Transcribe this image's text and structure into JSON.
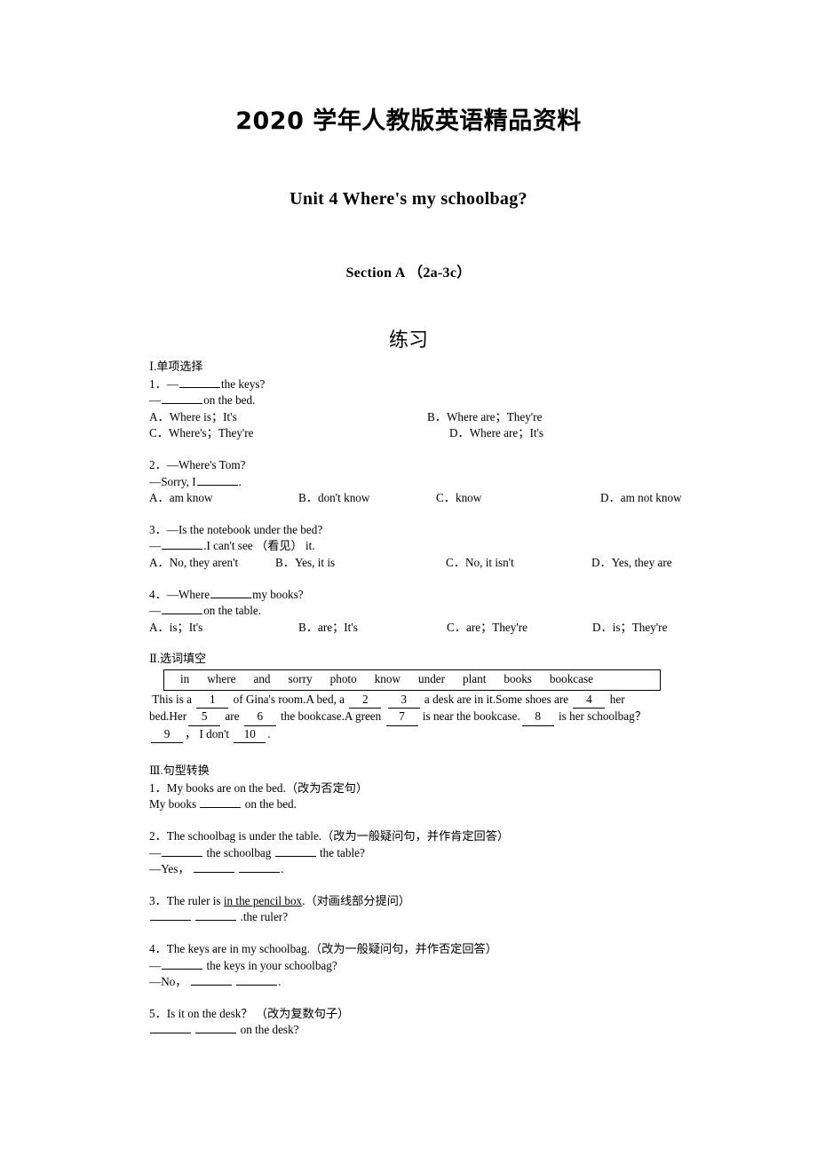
{
  "header": {
    "doc_title": "2020 学年人教版英语精品资料",
    "unit_title": "Unit 4    Where's my schoolbag?",
    "section_title": "Section A  （2a-3c）",
    "exercise_title": "练习"
  },
  "part1": {
    "heading": "Ⅰ.单项选择",
    "questions": [
      {
        "stem": "1．—",
        "stem_rest": "the keys?",
        "answer_line_prefix": "—",
        "answer_line_rest": "on the bed.",
        "options": [
          {
            "letter": "A．",
            "text": "Where is；It's"
          },
          {
            "letter": "B．",
            "text": "Where are；They're"
          },
          {
            "letter": "C．",
            "text": "Where's；They're"
          },
          {
            "letter": "D．",
            "text": "Where are；It's"
          }
        ]
      },
      {
        "stem": "2．—Where's Tom?",
        "answer_line_prefix": "—Sorry, I",
        "answer_line_rest": ".",
        "options": [
          {
            "letter": "A．",
            "text": "am know"
          },
          {
            "letter": "B．",
            "text": "don't know"
          },
          {
            "letter": "C．",
            "text": "know"
          },
          {
            "letter": "D．",
            "text": "am not know"
          }
        ]
      },
      {
        "stem": "3．—Is the notebook under the bed?",
        "answer_line_prefix": "—",
        "answer_line_rest": ".I can't see （看见） it.",
        "options": [
          {
            "letter": "A．",
            "text": "No, they aren't"
          },
          {
            "letter": "B．",
            "text": "Yes, it is"
          },
          {
            "letter": "C．",
            "text": "No, it isn't"
          },
          {
            "letter": "D．",
            "text": "Yes, they are"
          }
        ]
      },
      {
        "stem": "4．—Where",
        "stem_rest": "my books?",
        "answer_line_prefix": "—",
        "answer_line_rest": "on the table.",
        "options": [
          {
            "letter": "A．",
            "text": "is；It's"
          },
          {
            "letter": "B．",
            "text": "are；It's"
          },
          {
            "letter": "C．",
            "text": "are；They're"
          },
          {
            "letter": "D．",
            "text": "is；They're"
          }
        ]
      }
    ]
  },
  "part2": {
    "heading": "Ⅱ.选词填空",
    "word_bank": [
      "in",
      "where",
      "and",
      "sorry",
      "photo",
      "know",
      "under",
      "plant",
      "books",
      "bookcase"
    ],
    "cloze": {
      "line1_a": "This is a",
      "n1": "1",
      "line1_b": "of Gina's room.A bed, a",
      "n2": "2",
      "n3": "3",
      "line1_c": "a desk are in it.Some shoes are",
      "n4": "4",
      "line1_d": "her",
      "line2_a": "bed.Her",
      "n5": "5",
      "line2_b": "are",
      "n6": "6",
      "line2_c": "the bookcase.A green",
      "n7": "7",
      "line2_d": "is near the bookcase.",
      "n8": "8",
      "line2_e": "is her schoolbag？",
      "n9": "9",
      "line3_a": "，  I don't",
      "n10": "10",
      "line3_b": "."
    }
  },
  "part3": {
    "heading": "Ⅲ.句型转换",
    "questions": [
      {
        "stem": "1．My books are on the bed.（改为否定句）",
        "lines": [
          {
            "prefix": "My books",
            "suffix": "on the bed."
          }
        ]
      },
      {
        "stem": "2．The schoolbag is under the table.（改为一般疑问句，并作肯定回答）",
        "lines": [
          {
            "prefix": "—",
            "mid": "the schoolbag",
            "suffix": "the table?"
          },
          {
            "prefix": "—Yes，",
            "suffix": "."
          }
        ]
      },
      {
        "stem_pre": "3．The ruler is ",
        "stem_underline": "in the pencil box",
        "stem_post": ".（对画线部分提问）",
        "lines": [
          {
            "suffix": ".the ruler?"
          }
        ]
      },
      {
        "stem": "4．The keys are in my schoolbag.（改为一般疑问句，并作否定回答）",
        "lines": [
          {
            "prefix": "—",
            "suffix": "the keys in your schoolbag?"
          },
          {
            "prefix": "—No，",
            "suffix": "."
          }
        ]
      },
      {
        "stem": "5．Is it on the desk？ （改为复数句子）",
        "lines": [
          {
            "suffix": "on the desk?"
          }
        ]
      }
    ]
  }
}
